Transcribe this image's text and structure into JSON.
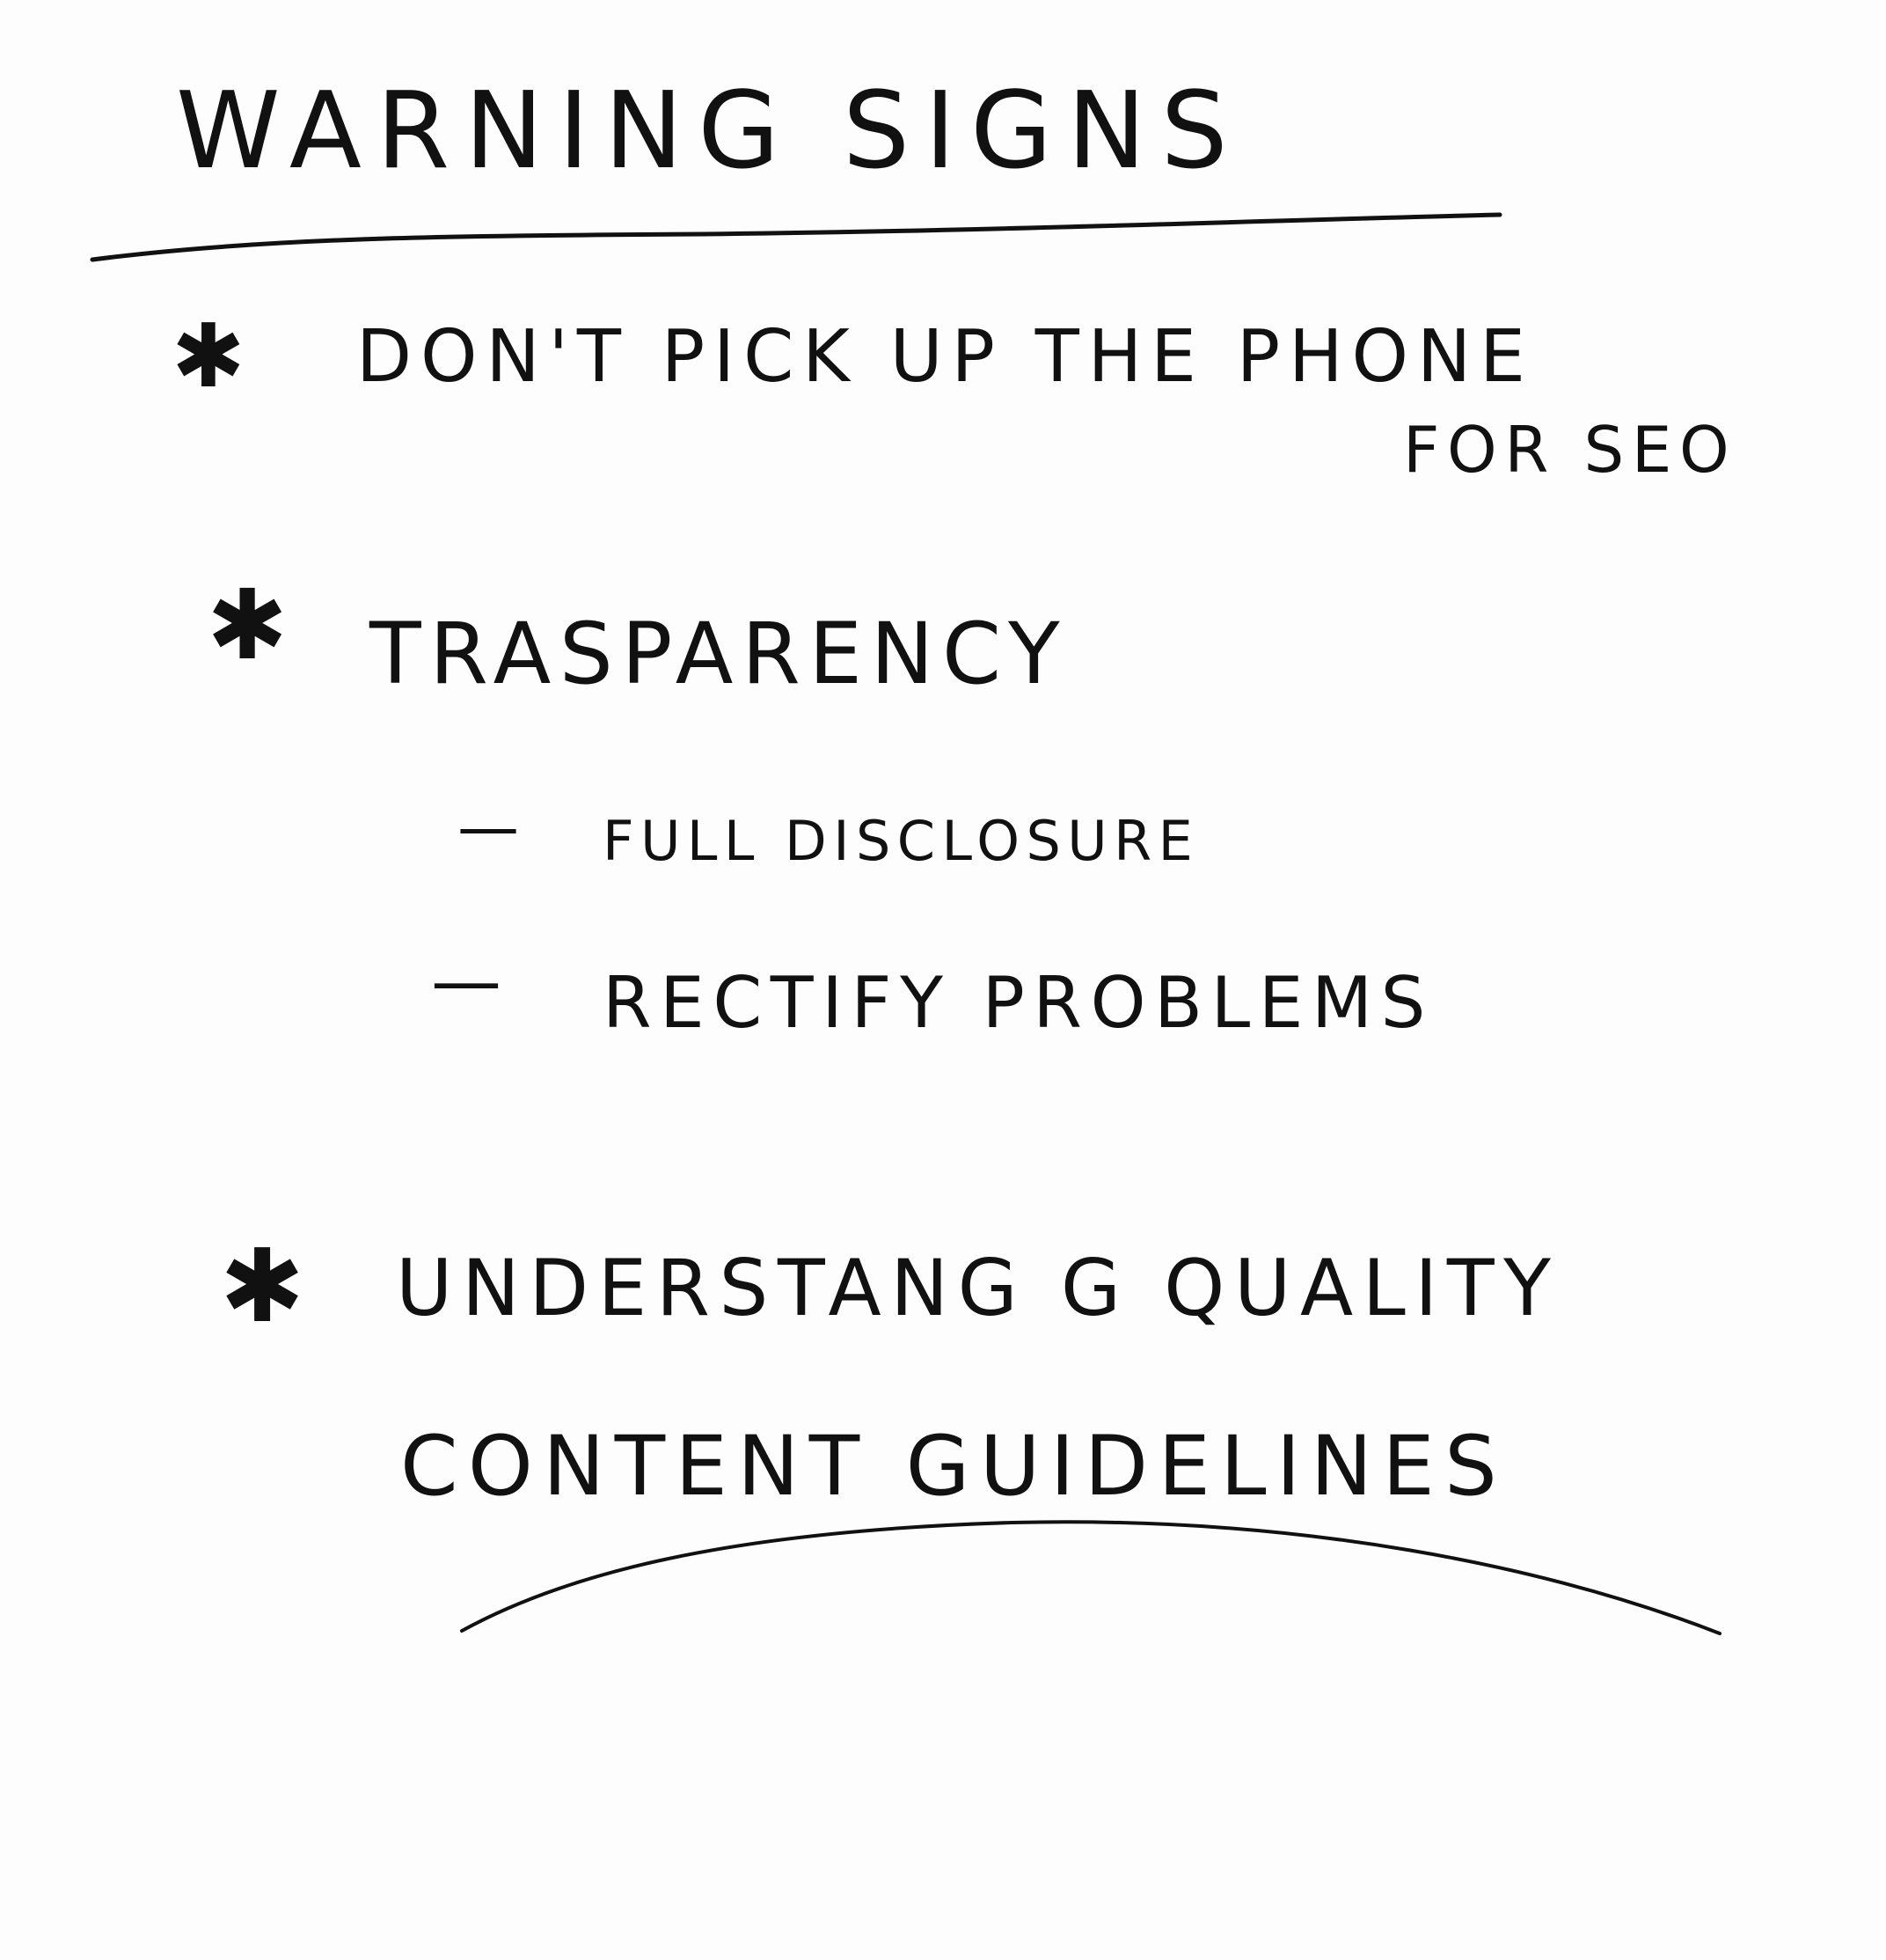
{
  "note": {
    "title": "WARNING SIGNS",
    "bullet_symbol": "✱",
    "dash_symbol": "—",
    "items": [
      {
        "line1": "DON'T PICK UP THE PHONE",
        "line2": "FOR SEO"
      },
      {
        "line1": "TRASPARENCY",
        "subitems": [
          "FULL DISCLOSURE",
          "RECTIFY PROBLEMS"
        ]
      },
      {
        "line1": "UNDERSTANG G QUALITY",
        "line2": "CONTENT GUIDELINES"
      }
    ]
  }
}
